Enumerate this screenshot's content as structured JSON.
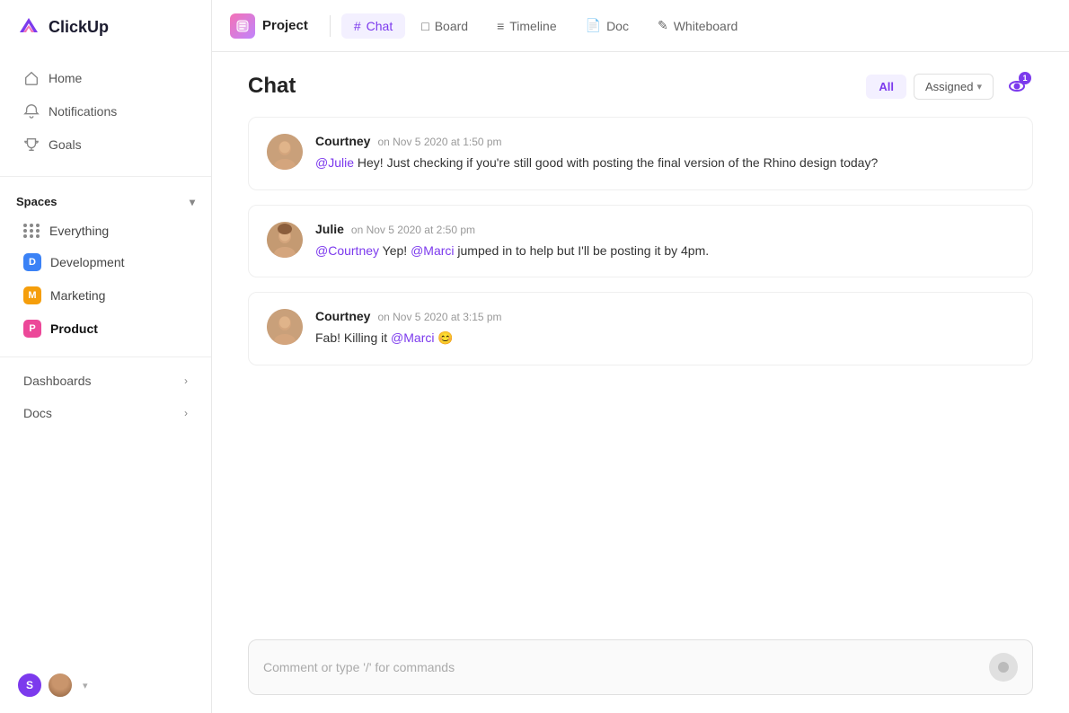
{
  "app": {
    "name": "ClickUp"
  },
  "sidebar": {
    "nav": [
      {
        "id": "home",
        "label": "Home",
        "icon": "home"
      },
      {
        "id": "notifications",
        "label": "Notifications",
        "icon": "bell"
      },
      {
        "id": "goals",
        "label": "Goals",
        "icon": "trophy"
      }
    ],
    "spaces_label": "Spaces",
    "spaces": [
      {
        "id": "everything",
        "label": "Everything",
        "type": "grid"
      },
      {
        "id": "development",
        "label": "Development",
        "abbr": "D",
        "color": "#3b82f6"
      },
      {
        "id": "marketing",
        "label": "Marketing",
        "abbr": "M",
        "color": "#f59e0b"
      },
      {
        "id": "product",
        "label": "Product",
        "abbr": "P",
        "color": "#ec4899"
      }
    ],
    "sections": [
      {
        "id": "dashboards",
        "label": "Dashboards"
      },
      {
        "id": "docs",
        "label": "Docs"
      }
    ],
    "bottom_users": [
      "S"
    ]
  },
  "topbar": {
    "project_label": "Project",
    "tabs": [
      {
        "id": "chat",
        "label": "Chat",
        "icon": "#",
        "active": true
      },
      {
        "id": "board",
        "label": "Board",
        "icon": "□"
      },
      {
        "id": "timeline",
        "label": "Timeline",
        "icon": "≡"
      },
      {
        "id": "doc",
        "label": "Doc",
        "icon": "📄"
      },
      {
        "id": "whiteboard",
        "label": "Whiteboard",
        "icon": "✎"
      }
    ]
  },
  "chat": {
    "title": "Chat",
    "filter_all": "All",
    "filter_assigned": "Assigned",
    "eye_badge_count": "1",
    "messages": [
      {
        "id": "msg1",
        "author": "Courtney",
        "time": "on Nov 5 2020 at 1:50 pm",
        "mention": "@Julie",
        "text_pre": " Hey! Just checking if you're still good with posting the final version of the Rhino design today?"
      },
      {
        "id": "msg2",
        "author": "Julie",
        "time": "on Nov 5 2020 at 2:50 pm",
        "mention": "@Courtney",
        "text_mid1": " Yep! ",
        "mention2": "@Marci",
        "text_mid2": " jumped in to help but I'll be posting it by 4pm."
      },
      {
        "id": "msg3",
        "author": "Courtney",
        "time": "on Nov 5 2020 at 3:15 pm",
        "text_pre": "Fab! Killing it ",
        "mention": "@Marci",
        "emoji": "😊"
      }
    ],
    "comment_placeholder": "Comment or type '/' for commands"
  }
}
